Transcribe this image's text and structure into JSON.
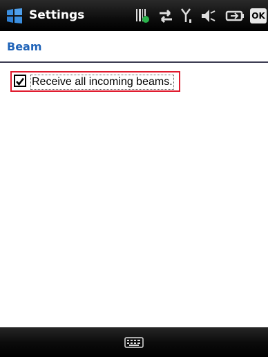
{
  "titlebar": {
    "app_title": "Settings",
    "ok_label": "OK",
    "icons": [
      "start-menu-icon",
      "barcode-scanner-icon",
      "data-connection-icon",
      "signal-strength-icon",
      "volume-icon",
      "battery-icon"
    ]
  },
  "header": {
    "page_title": "Beam"
  },
  "content": {
    "receive_beams": {
      "label": "Receive all incoming beams.",
      "checked": true
    }
  },
  "bottom_bar": {
    "icons": [
      "keyboard-icon"
    ]
  },
  "colors": {
    "page_title": "#1f63b8",
    "highlight_border": "#e01a2d",
    "bar_background": "#000000"
  }
}
